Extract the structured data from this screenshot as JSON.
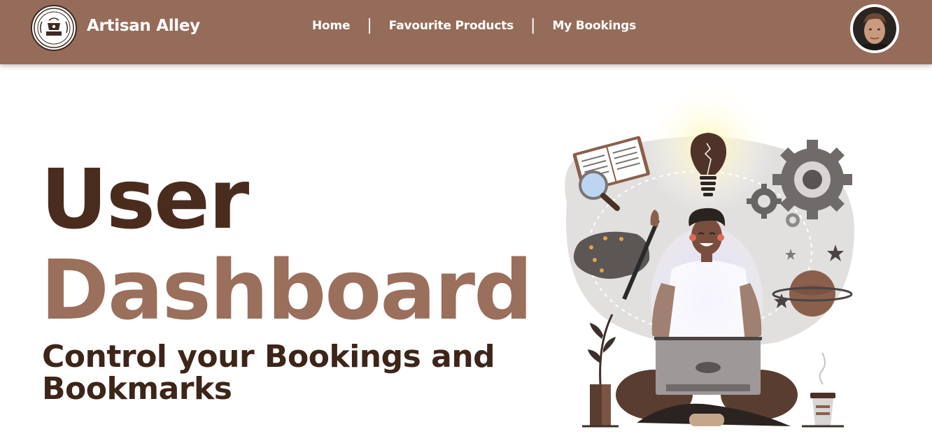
{
  "header": {
    "brand_name": "Artisan Alley",
    "logo_icon": "artisan-alley-seal-logo",
    "nav": {
      "home": "Home",
      "separator": "|",
      "favourites": "Favourite Products",
      "bookings": "My Bookings"
    },
    "avatar_icon": "user-avatar"
  },
  "hero": {
    "title_line1": "User",
    "title_line2": "Dashboard",
    "subtitle": "Control your Bookings and Bookmarks",
    "illustration_icon": "creative-person-with-laptop-illustration"
  },
  "colors": {
    "header_bg": "#956c5a",
    "title_dark": "#4a2c1f",
    "title_light": "#9a6f5c",
    "subtitle": "#3d2519"
  }
}
